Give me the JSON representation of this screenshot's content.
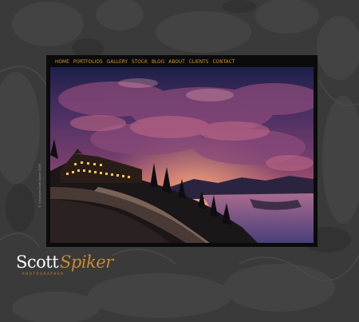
{
  "nav": {
    "items": [
      "HOME",
      "PORTFOLIOS",
      "GALLERY",
      "STOCK",
      "BLOG",
      "ABOUT",
      "CLIENTS",
      "CONTACT"
    ]
  },
  "photo": {
    "subject": "lodge-at-lake-sunset"
  },
  "copyright": "© Copyright Scott Spiker 2009",
  "logo": {
    "first": "Scott",
    "last": "Spiker",
    "tagline": "PHOTOGRAPHER"
  },
  "colors": {
    "accent": "#d49a3d",
    "background": "#3b3b3b",
    "frame": "#0b0b0b"
  }
}
